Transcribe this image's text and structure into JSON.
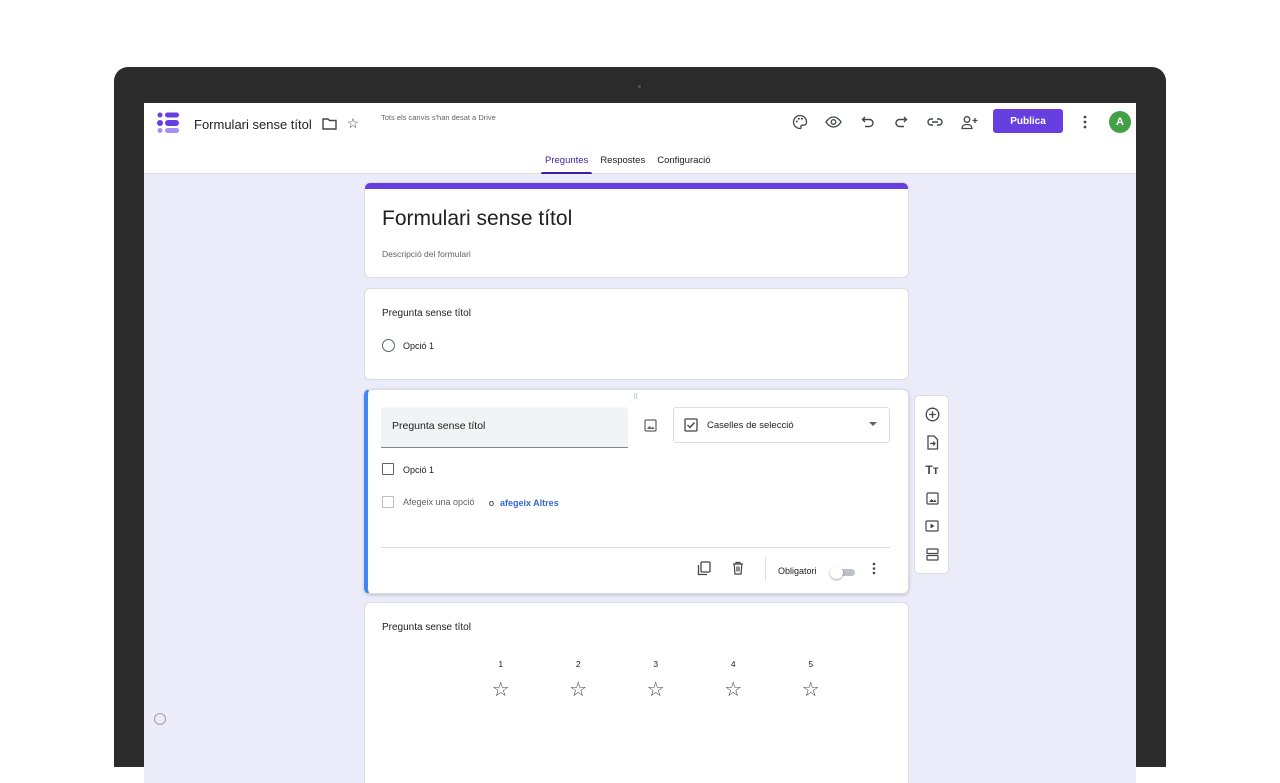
{
  "header": {
    "doc_title": "Formulari sense títol",
    "save_status": "Tots els canvis s'han desat a Drive",
    "publish_label": "Publica",
    "avatar_initial": "A",
    "icons": [
      "folder-icon",
      "star-icon",
      "palette-icon",
      "preview-icon",
      "undo-icon",
      "redo-icon",
      "link-icon",
      "add-collaborator-icon",
      "more-vert-icon"
    ]
  },
  "tabs": [
    {
      "label": "Preguntes",
      "active": true
    },
    {
      "label": "Respostes",
      "active": false
    },
    {
      "label": "Configuració",
      "active": false
    }
  ],
  "form": {
    "title": "Formulari sense títol",
    "description": "Descripció del formulari"
  },
  "questions": [
    {
      "title": "Pregunta sense títol",
      "type": "radio",
      "options": [
        "Opció 1"
      ]
    },
    {
      "title": "Pregunta sense títol",
      "type_label": "Caselles de selecció",
      "options": [
        "Opció 1"
      ],
      "add_option": "Afegeix una opció",
      "or": "o",
      "add_other": "afegeix Altres",
      "required_label": "Obligatori",
      "required": false
    },
    {
      "title": "Pregunta sense títol",
      "type": "rating",
      "scale": [
        "1",
        "2",
        "3",
        "4",
        "5"
      ],
      "rating_icon": "☆"
    }
  ],
  "side_toolbar": [
    "add-question-icon",
    "import-questions-icon",
    "add-title-icon",
    "add-image-icon",
    "add-video-icon",
    "add-section-icon"
  ],
  "colors": {
    "accent": "#673ee0",
    "active_card": "#4285f4",
    "background": "#ecebf9"
  }
}
